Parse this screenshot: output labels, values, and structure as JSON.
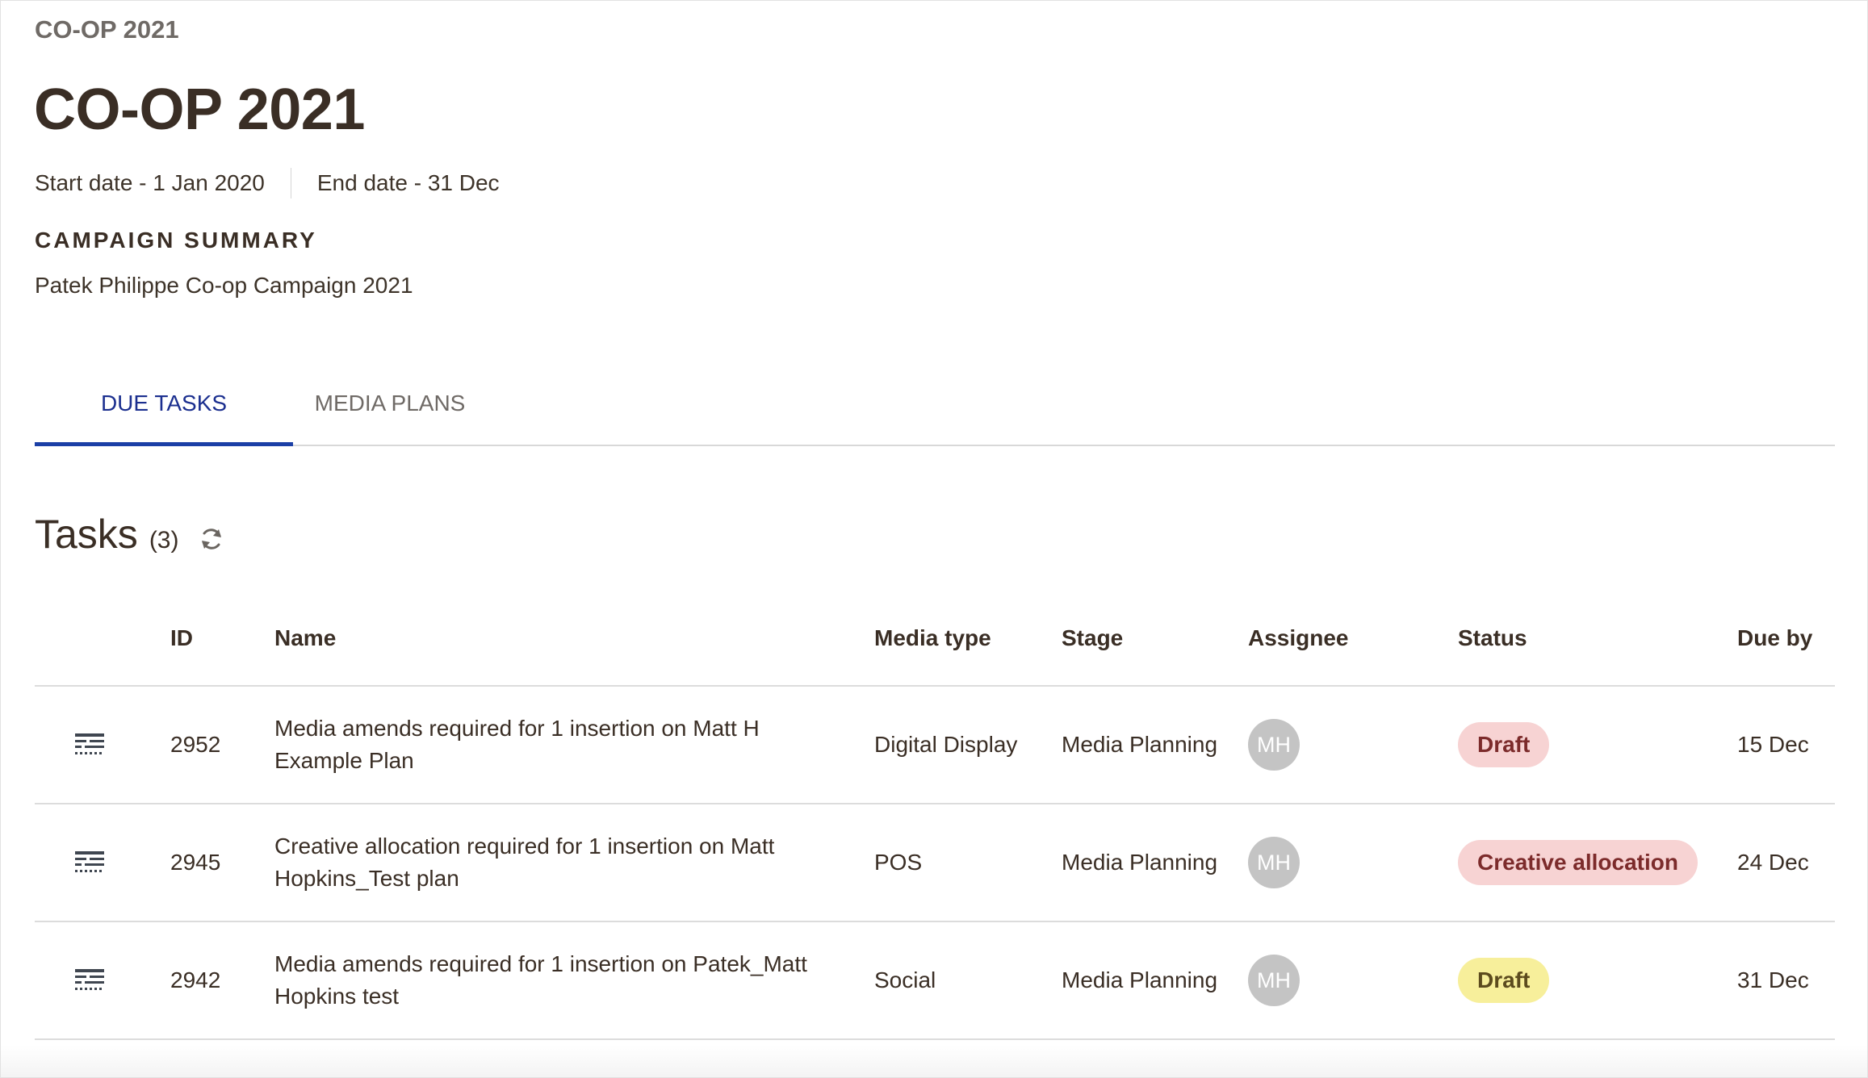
{
  "breadcrumb": "CO-OP 2021",
  "title": "CO-OP 2021",
  "dates": {
    "start": "Start date - 1 Jan 2020",
    "end": "End date - 31 Dec"
  },
  "summary": {
    "heading": "CAMPAIGN SUMMARY",
    "text": "Patek Philippe Co-op Campaign 2021"
  },
  "tabs": [
    {
      "label": "DUE TASKS",
      "active": true
    },
    {
      "label": "MEDIA PLANS",
      "active": false
    }
  ],
  "tasks": {
    "title": "Tasks",
    "count": "(3)",
    "refresh_icon": "refresh-icon"
  },
  "table": {
    "headers": {
      "id": "ID",
      "name": "Name",
      "media_type": "Media type",
      "stage": "Stage",
      "assignee": "Assignee",
      "status": "Status",
      "due_by": "Due by"
    },
    "rows": [
      {
        "icon": "task-list-icon",
        "id": "2952",
        "name": "Media amends required for 1 insertion on Matt H Example Plan",
        "media_type": "Digital Display",
        "stage": "Media Planning",
        "assignee": "MH",
        "status": "Draft",
        "status_color": "#f7d3d3",
        "due": "15 Dec"
      },
      {
        "icon": "task-list-icon",
        "id": "2945",
        "name": "Creative allocation required for 1 insertion on Matt Hopkins_Test plan",
        "media_type": "POS",
        "stage": "Media Planning",
        "assignee": "MH",
        "status": "Creative allocation",
        "status_color": "#f7d3d3",
        "due": "24 Dec"
      },
      {
        "icon": "task-list-icon",
        "id": "2942",
        "name": "Media amends required for 1 insertion on Patek_Matt Hopkins test",
        "media_type": "Social",
        "stage": "Media Planning",
        "assignee": "MH",
        "status": "Draft",
        "status_color": "#f7ef9b",
        "due": "31 Dec"
      }
    ]
  },
  "colors": {
    "accent": "#1b3fa6",
    "title": "#3a2e25",
    "avatar": "#c4c4c4"
  }
}
